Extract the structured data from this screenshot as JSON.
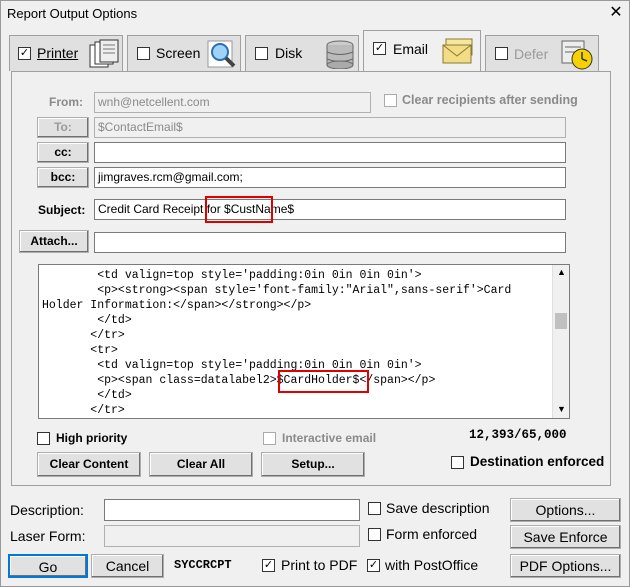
{
  "window": {
    "title": "Report Output Options",
    "close_glyph": "✕"
  },
  "tabs": [
    {
      "label": "Printer",
      "checked": true,
      "icon": "printer-pages-icon"
    },
    {
      "label": "Screen",
      "checked": false,
      "icon": "magnifier-icon"
    },
    {
      "label": "Disk",
      "checked": false,
      "icon": "disk-stack-icon"
    },
    {
      "label": "Email",
      "checked": true,
      "icon": "envelope-icon"
    },
    {
      "label": "Defer",
      "checked": false,
      "icon": "clock-icon"
    }
  ],
  "email": {
    "from_label": "From:",
    "from_value": "wnh@netcellent.com",
    "clear_recipients_label": "Clear recipients after sending",
    "to_button": "To:",
    "to_value": "$ContactEmail$",
    "cc_button": "cc:",
    "cc_value": "",
    "bcc_button": "bcc:",
    "bcc_value": "jimgraves.rcm@gmail.com;",
    "subject_label": "Subject:",
    "subject_prefix": "Credit Card Receipt for ",
    "subject_var": "$CustName$",
    "attach_button": "Attach...",
    "attach_value": "",
    "body_lines": [
      "        <td valign=top style='padding:0in 0in 0in 0in'>",
      "        <p><strong><span style='font-family:\"Arial\",sans-serif'>Card",
      "Holder Information:</span></strong></p>",
      "        </td>",
      "       </tr>",
      "       <tr>",
      "        <td valign=top style='padding:0in 0in 0in 0in'>",
      "        <p><span class=datalabel2>$CardHolder$</span></p>",
      "        </td>",
      "       </tr>"
    ],
    "high_priority_label": "High priority",
    "interactive_email_label": "Interactive email",
    "char_count": "12,393/65,000",
    "clear_content_button": "Clear Content",
    "clear_all_button": "Clear All",
    "setup_button": "Setup...",
    "destination_enforced_label": "Destination enforced"
  },
  "bottom": {
    "description_label": "Description:",
    "description_value": "",
    "save_description_label": "Save description",
    "options_button": "Options...",
    "laser_form_label": "Laser Form:",
    "laser_form_value": "",
    "form_enforced_label": "Form enforced",
    "save_enforce_button": "Save Enforce",
    "go_button": "Go",
    "cancel_button": "Cancel",
    "report_code": "SYCCRCPT",
    "print_to_pdf_label": "Print to PDF",
    "with_postoffice_label": "with PostOffice",
    "pdf_options_button": "PDF Options..."
  },
  "colors": {
    "highlight_box": "#e00000"
  }
}
